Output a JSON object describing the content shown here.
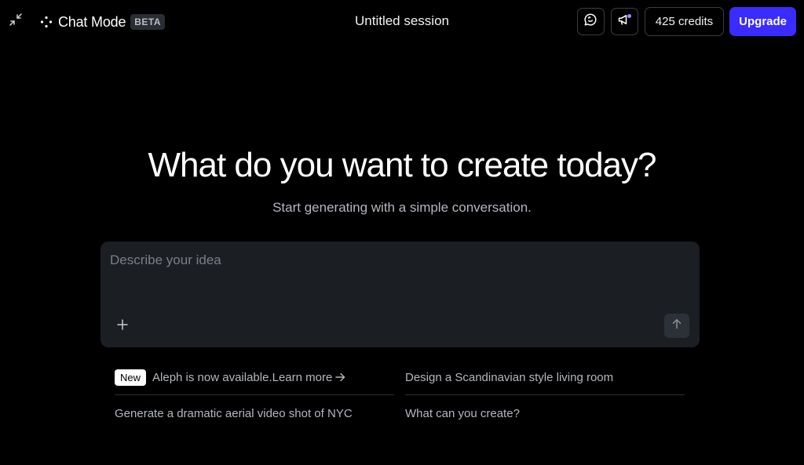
{
  "header": {
    "mode_name": "Chat Mode",
    "beta_label": "BETA",
    "session_title": "Untitled session",
    "credits_label": "425 credits",
    "upgrade_label": "Upgrade"
  },
  "icons": {
    "collapse": "collapse-arrows-icon",
    "brand": "sparkle-dots-icon",
    "feedback": "chat-bubble-icon",
    "announcements": "megaphone-icon",
    "attach": "plus-icon",
    "send": "arrow-up-icon",
    "learn_more": "arrow-right-icon"
  },
  "colors": {
    "accent": "#3a2bff",
    "background": "#000000",
    "prompt_bg": "#1b1e23"
  },
  "hero": {
    "title": "What do you want to create today?",
    "subtitle": "Start generating with a simple conversation."
  },
  "prompt": {
    "placeholder": "Describe your idea",
    "value": ""
  },
  "suggestions": {
    "new_badge": "New",
    "announcement": "Aleph is now available.",
    "learn_more": "Learn more",
    "items": [
      "Design a Scandinavian style living room",
      "Generate a dramatic aerial video shot of NYC",
      "What can you create?"
    ]
  }
}
